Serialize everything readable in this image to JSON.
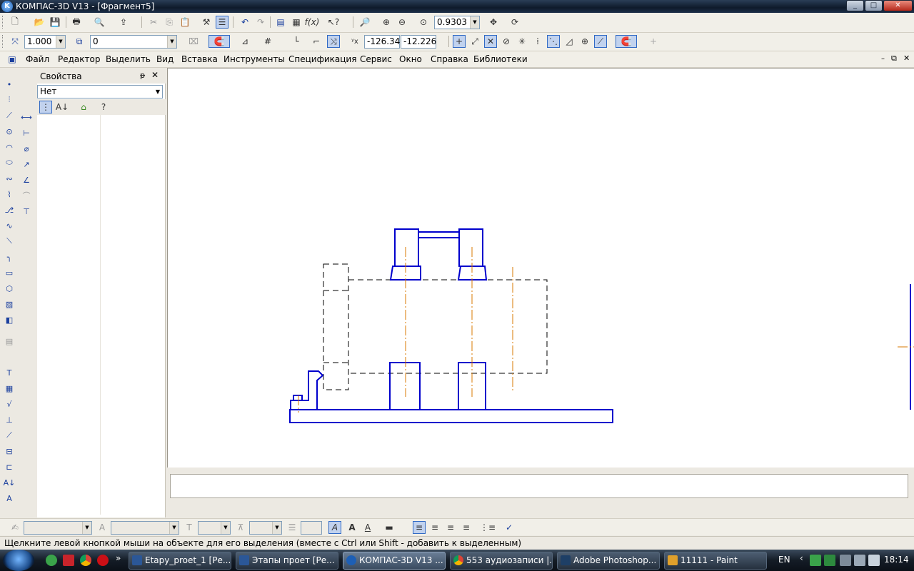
{
  "window": {
    "title": "КОМПАС-3D V13 - [Фрагмент5]",
    "minimize": "_",
    "maximize": "□",
    "close": "✕"
  },
  "toolbar_main": {
    "zoom_value": "0.9303"
  },
  "toolbar_current": {
    "scale_value": "1.000",
    "layer_value": "0",
    "coord_x": "-126.34",
    "coord_y": "-12.226"
  },
  "menu": {
    "items": [
      "Файл",
      "Редактор",
      "Выделить",
      "Вид",
      "Вставка",
      "Инструменты",
      "Спецификация",
      "Сервис",
      "Окно",
      "Справка",
      "Библиотеки"
    ]
  },
  "properties": {
    "title": "Свойства",
    "selected": "Нет",
    "pin": "ᵽ",
    "close": "✕"
  },
  "status": {
    "text": "Щелкните левой кнопкой мыши на объекте для его выделения (вместе с Ctrl или Shift - добавить к выделенным)"
  },
  "taskbar": {
    "items": [
      {
        "label": "Etapy_proet_1 [Ре...",
        "color": "#2b5797"
      },
      {
        "label": "Этапы проет [Ре...",
        "color": "#2b5797"
      },
      {
        "label": "КОМПАС-3D V13 ...",
        "color": "#1d5fb5"
      },
      {
        "label": "553 аудиозаписи |...",
        "color": "#d64a2f"
      },
      {
        "label": "Adobe Photoshop...",
        "color": "#1e3f66"
      },
      {
        "label": "11111 - Paint",
        "color": "#e0a02b"
      }
    ],
    "more": "»",
    "lang": "EN",
    "clock": "18:14"
  },
  "drawing_colors": {
    "outline": "#0000cc",
    "axis": "#d97a00",
    "hidden": "#000000"
  }
}
